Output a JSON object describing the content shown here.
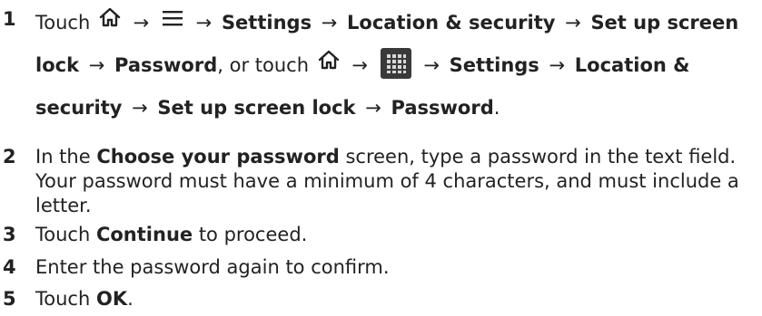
{
  "symbols": {
    "arrow": "→"
  },
  "steps": [
    {
      "number": "1",
      "t_touch": "Touch",
      "t_comma_or_touch": ", or touch",
      "settings": "Settings",
      "location_security": "Location & security",
      "set_up_screen_lock": "Set up screen lock",
      "password": "Password",
      "period": "."
    },
    {
      "number": "2",
      "t_in_the": "In the",
      "choose_your_password": "Choose your password",
      "t_rest": "screen, type a password in the text field. Your password must have a minimum of 4 characters, and must include a letter."
    },
    {
      "number": "3",
      "t_touch": "Touch",
      "continue": "Continue",
      "t_rest": "to proceed."
    },
    {
      "number": "4",
      "text": "Enter the password again to confirm."
    },
    {
      "number": "5",
      "t_touch": "Touch",
      "ok": "OK",
      "period": "."
    }
  ],
  "icons": {
    "home": "home-icon",
    "menu": "menu-icon",
    "apps": "apps-grid-icon"
  }
}
